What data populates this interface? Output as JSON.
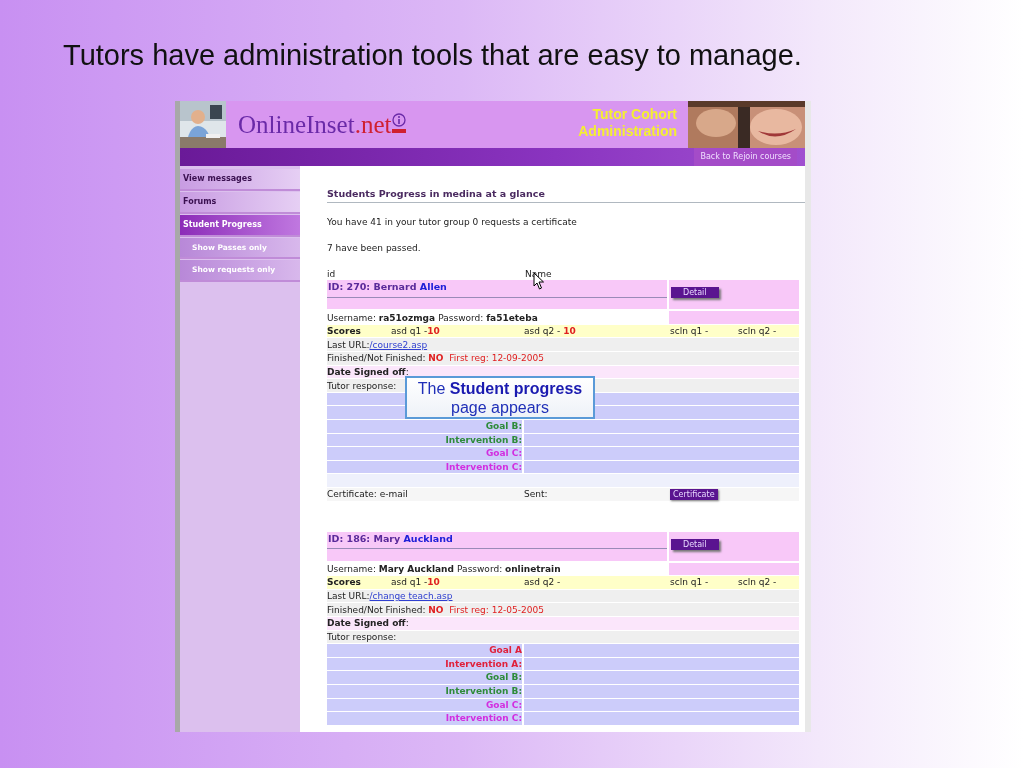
{
  "slide": {
    "title": "Tutors have administration tools that are easy to manage."
  },
  "site": {
    "logo_main": "OnlineInset",
    "logo_suffix": ".net",
    "banner": [
      "Tutor Cohort",
      "Administration"
    ],
    "back_button": "Back to Rejoin courses"
  },
  "sidebar": [
    {
      "label": "View messages",
      "selected": false
    },
    {
      "label": "Forums",
      "selected": false
    },
    {
      "label": "Student Progress",
      "selected": true,
      "children": [
        {
          "label": "Show Passes only",
          "selected": false
        },
        {
          "label": "Show requests only",
          "selected": false
        }
      ]
    }
  ],
  "page": {
    "heading": "Students Progress in medina at a glance",
    "summary": "You have 41 in your tutor group 0 requests a certificate",
    "passed": "7 have been passed.",
    "columns": [
      "id",
      "Name"
    ]
  },
  "students": [
    {
      "id_label": "ID: 270: Bernard",
      "surname": "Allen",
      "detail_button": "Detail",
      "username_label": "Username:",
      "username": "ra51ozmga",
      "password_label": "Password:",
      "password": "fa51eteba",
      "scores_label": "Scores",
      "scores": [
        {
          "label": "asd q1 -",
          "value": "10"
        },
        {
          "label": "asd q2 - ",
          "value": "10"
        },
        {
          "label": "scln q1 -"
        },
        {
          "label": "scln q2 -"
        }
      ],
      "last_url_label": "Last URL:",
      "last_url": "/course2.asp",
      "finished_label": "Finished/Not Finished:",
      "finished": "NO",
      "first_reg": "First reg: 12-09-2005",
      "signed_off": "**Date Signed off**:",
      "tutor_response": "Tutor response:",
      "goals": [
        {
          "kind": "covered"
        },
        {
          "kind": "covered"
        },
        {
          "kind": "label",
          "label": "Goal B:",
          "color": "#2e8b3a"
        },
        {
          "kind": "label",
          "label": "Intervention B:",
          "color": "#2e8b3a"
        },
        {
          "kind": "label",
          "label": "Goal C:",
          "color": "#d22ee0"
        },
        {
          "kind": "label",
          "label": "Intervention C:",
          "color": "#d22ee0"
        }
      ],
      "certificate": {
        "label": "Certificate: e-mail",
        "sent": "Sent:",
        "button": "Certificate"
      }
    },
    {
      "id_label": "ID: 186: Mary",
      "surname": "Auckland",
      "detail_button": "Detail",
      "username_label": "Username:",
      "username": "Mary Auckland",
      "password_label": "Password:",
      "password": "onlinetrain",
      "scores_label": "Scores",
      "scores": [
        {
          "label": "asd q1 -",
          "value": "10"
        },
        {
          "label": "asd q2 -"
        },
        {
          "label": "scln q1 -"
        },
        {
          "label": "scln q2 -"
        }
      ],
      "last_url_label": "Last URL:",
      "last_url": "/change teach.asp",
      "finished_label": "Finished/Not Finished:",
      "finished": "NO",
      "first_reg": "First reg: 12-05-2005",
      "signed_off": "**Date Signed off**:",
      "tutor_response": "Tutor response:",
      "goals": [
        {
          "kind": "label",
          "label": "Goal A",
          "color": "#e0203a"
        },
        {
          "kind": "label",
          "label": "Intervention A:",
          "color": "#e0203a"
        },
        {
          "kind": "label",
          "label": "Goal B:",
          "color": "#2e8b3a"
        },
        {
          "kind": "label",
          "label": "Intervention B:",
          "color": "#2e8b3a"
        },
        {
          "kind": "label",
          "label": "Goal C:",
          "color": "#d22ee0"
        },
        {
          "kind": "label",
          "label": "Intervention C:",
          "color": "#d22ee0"
        }
      ]
    }
  ],
  "callout": {
    "text": "The **Student progress** page appears"
  }
}
